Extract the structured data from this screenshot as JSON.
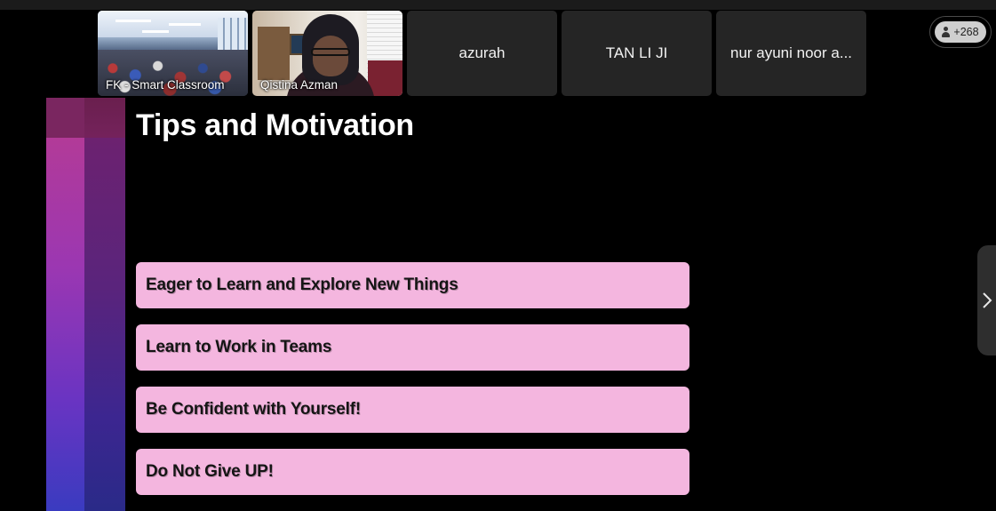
{
  "participants": [
    {
      "name": "FK - Smart Classroom",
      "video": true
    },
    {
      "name": "Qistina Azman",
      "video": true
    },
    {
      "name": "azurah",
      "video": false
    },
    {
      "name": "TAN LI JI",
      "video": false
    },
    {
      "name": "nur ayuni noor a...",
      "video": false
    }
  ],
  "participant_count": "+268",
  "icons": {
    "count": "person-icon",
    "next": "chevron-right-icon"
  },
  "slide": {
    "title": "Tips and Motivation",
    "tips": [
      "Eager to Learn and Explore New Things",
      "Learn to Work in Teams",
      "Be Confident with Yourself!",
      "Do Not Give UP!"
    ],
    "colors": {
      "tip_background": "#f4b6df",
      "accent_magenta": "#b23a98",
      "accent_indigo": "#3a3bc0"
    }
  }
}
